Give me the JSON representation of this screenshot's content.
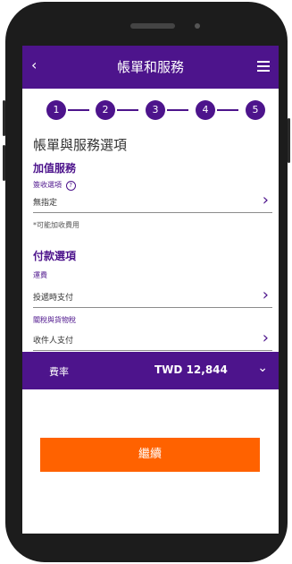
{
  "header": {
    "title": "帳單和服務",
    "back_icon": "chevron-left-icon",
    "menu_icon": "hamburger-menu-icon"
  },
  "steps": [
    "1",
    "2",
    "3",
    "4",
    "5"
  ],
  "section": {
    "title": "帳單與服務選項"
  },
  "value_added": {
    "title": "加值服務",
    "signature_label": "簽收選項",
    "signature_value": "無指定",
    "note": "*可能加收費用"
  },
  "payment": {
    "title": "付款選項",
    "freight_label": "運費",
    "freight_value": "投遞時支付",
    "duties_label": "關稅與貨物稅",
    "duties_value": "收件人支付"
  },
  "rate": {
    "label": "費率",
    "value": "TWD 12,844"
  },
  "continue_label": "繼續",
  "colors": {
    "brand_purple": "#4d148c",
    "accent_orange": "#ff6200"
  }
}
